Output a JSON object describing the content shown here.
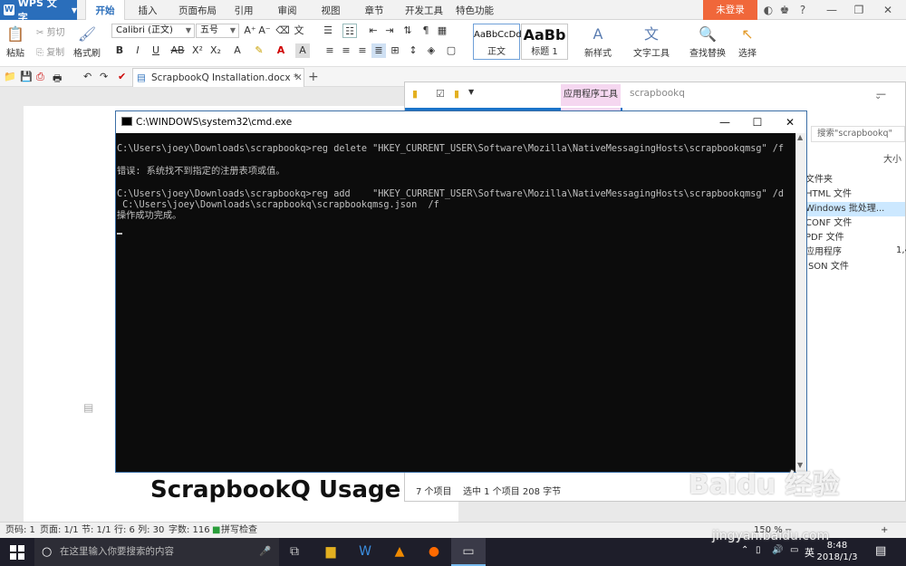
{
  "wps": {
    "app_name": "WPS 文字",
    "tabs": [
      "开始",
      "插入",
      "页面布局",
      "引用",
      "审阅",
      "视图",
      "章节",
      "开发工具",
      "特色功能"
    ],
    "login_label": "未登录",
    "clipboard": {
      "paste": "粘贴",
      "cut": "剪切",
      "copy": "复制",
      "format_painter": "格式刷"
    },
    "font_name": "Calibri (正文)",
    "font_size": "五号",
    "styles": [
      {
        "preview": "AaBbCcDd",
        "label": "正文"
      },
      {
        "preview": "AaBb",
        "label": "标题 1"
      }
    ],
    "new_style": "新样式",
    "text_tools": "文字工具",
    "find_replace": "查找替换",
    "select": "选择",
    "document_tab": "ScrapbookQ Installation.docx *"
  },
  "document": {
    "heading": "ScrapbookQ Usage"
  },
  "explorer": {
    "app_tools": "应用程序工具",
    "title": "scrapbookq",
    "search_placeholder": "搜索\"scrapbookq\"",
    "size_col": "大小",
    "types": [
      "文件夹",
      "HTML 文件",
      "Windows 批处理...",
      "CONF 文件",
      "PDF 文件",
      "应用程序",
      "JSON 文件"
    ],
    "type_values": [
      "",
      "",
      "",
      "",
      "",
      "1,4",
      ""
    ],
    "status_count": "7 个项目",
    "status_selected": "选中 1 个项目  208 字节"
  },
  "cmd": {
    "title": "C:\\WINDOWS\\system32\\cmd.exe",
    "lines": [
      "C:\\Users\\joey\\Downloads\\scrapbookq>reg delete \"HKEY_CURRENT_USER\\Software\\Mozilla\\NativeMessagingHosts\\scrapbookqmsg\" /f",
      "",
      "错误: 系统找不到指定的注册表项或值。",
      "",
      "C:\\Users\\joey\\Downloads\\scrapbookq>reg add    \"HKEY_CURRENT_USER\\Software\\Mozilla\\NativeMessagingHosts\\scrapbookqmsg\" /d",
      " C:\\Users\\joey\\Downloads\\scrapbookq\\scrapbookqmsg.json  /f",
      "操作成功完成。"
    ]
  },
  "statusbar": {
    "line": "页码: 1",
    "page": "页面: 1/1",
    "section": "节: 1/1",
    "rowcol": "行: 6  列: 30",
    "words": "字数: 116",
    "spell": "拼写检查",
    "zoom": "150 %"
  },
  "taskbar": {
    "search_placeholder": "在这里输入你要搜索的内容",
    "time": "8:48",
    "date": "2018/1/3",
    "ime": "英"
  },
  "watermark": {
    "main": "Baidu 经验",
    "sub": "jingyan.baidu.com"
  }
}
